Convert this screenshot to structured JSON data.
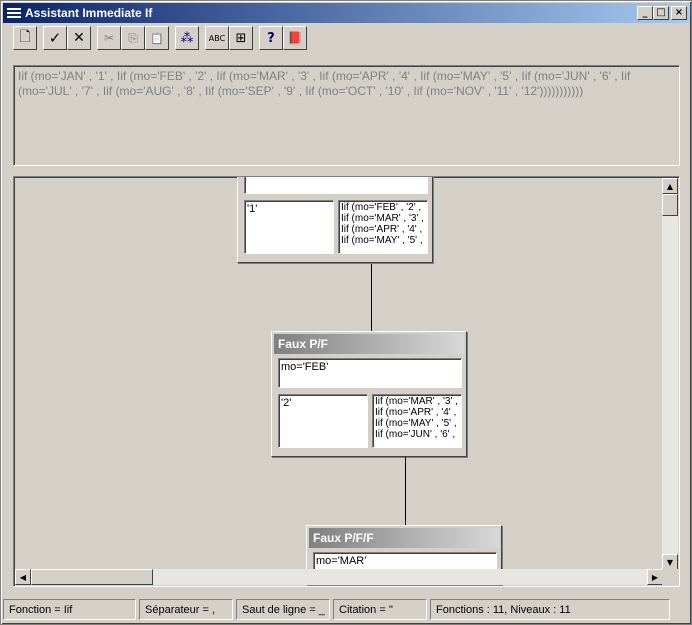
{
  "window": {
    "title": "Assistant Immediate If"
  },
  "caption_buttons": {
    "minimize": "_",
    "maximize": "□",
    "close": "×"
  },
  "toolbar": {
    "buttons": [
      {
        "name": "new-icon",
        "glyph": "🗋"
      },
      {
        "name": "checkmark-icon",
        "glyph": "✓"
      },
      {
        "name": "cross-icon",
        "glyph": "✕"
      },
      {
        "name": "cut-icon",
        "glyph": "✂"
      },
      {
        "name": "copy-icon",
        "glyph": "⎘"
      },
      {
        "name": "paste-icon",
        "glyph": "📋"
      },
      {
        "name": "tree-icon",
        "glyph": "⁂"
      },
      {
        "name": "spellcheck-icon",
        "glyph": "ABC"
      },
      {
        "name": "properties-icon",
        "glyph": "⊞"
      },
      {
        "name": "help-pointer-icon",
        "glyph": "?"
      },
      {
        "name": "book-icon",
        "glyph": "📕"
      }
    ]
  },
  "expression": "Iif (mo='JAN' , '1' , Iif (mo='FEB' , '2' , Iif (mo='MAR' , '3' , Iif (mo='APR' , '4' , Iif (mo='MAY' , '5' , Iif (mo='JUN' , '6' , Iif (mo='JUL' , '7' , Iif (mo='AUG' , '8' , Iif (mo='SEP' , '9' , Iif (mo='OCT' , '10' , Iif (mo='NOV' , '11' , '12')))))))))))",
  "tree": {
    "node1": {
      "condition": "",
      "true_value": "'1'",
      "false_lines": [
        "Iif (mo='FEB' , '2' ,",
        "Iif (mo='MAR' , '3' ,",
        "Iif (mo='APR' , '4' ,",
        "Iif (mo='MAY' , '5' ,"
      ]
    },
    "node2": {
      "header": "Faux P/F",
      "condition": "mo='FEB'",
      "true_value": "'2'",
      "false_lines": [
        "Iif (mo='MAR' , '3' ,",
        "Iif (mo='APR' , '4' ,",
        "Iif (mo='MAY' , '5' ,",
        "Iif (mo='JUN' , '6' ,"
      ]
    },
    "node3": {
      "header": "Faux P/F/F",
      "condition": "mo='MAR'"
    }
  },
  "status": {
    "function": "Fonction = Iif",
    "separator": "Séparateur = ,",
    "line_break": "Saut de ligne = _",
    "quote": "Citation = ''",
    "counts": "Fonctions : 11, Niveaux : 11"
  }
}
